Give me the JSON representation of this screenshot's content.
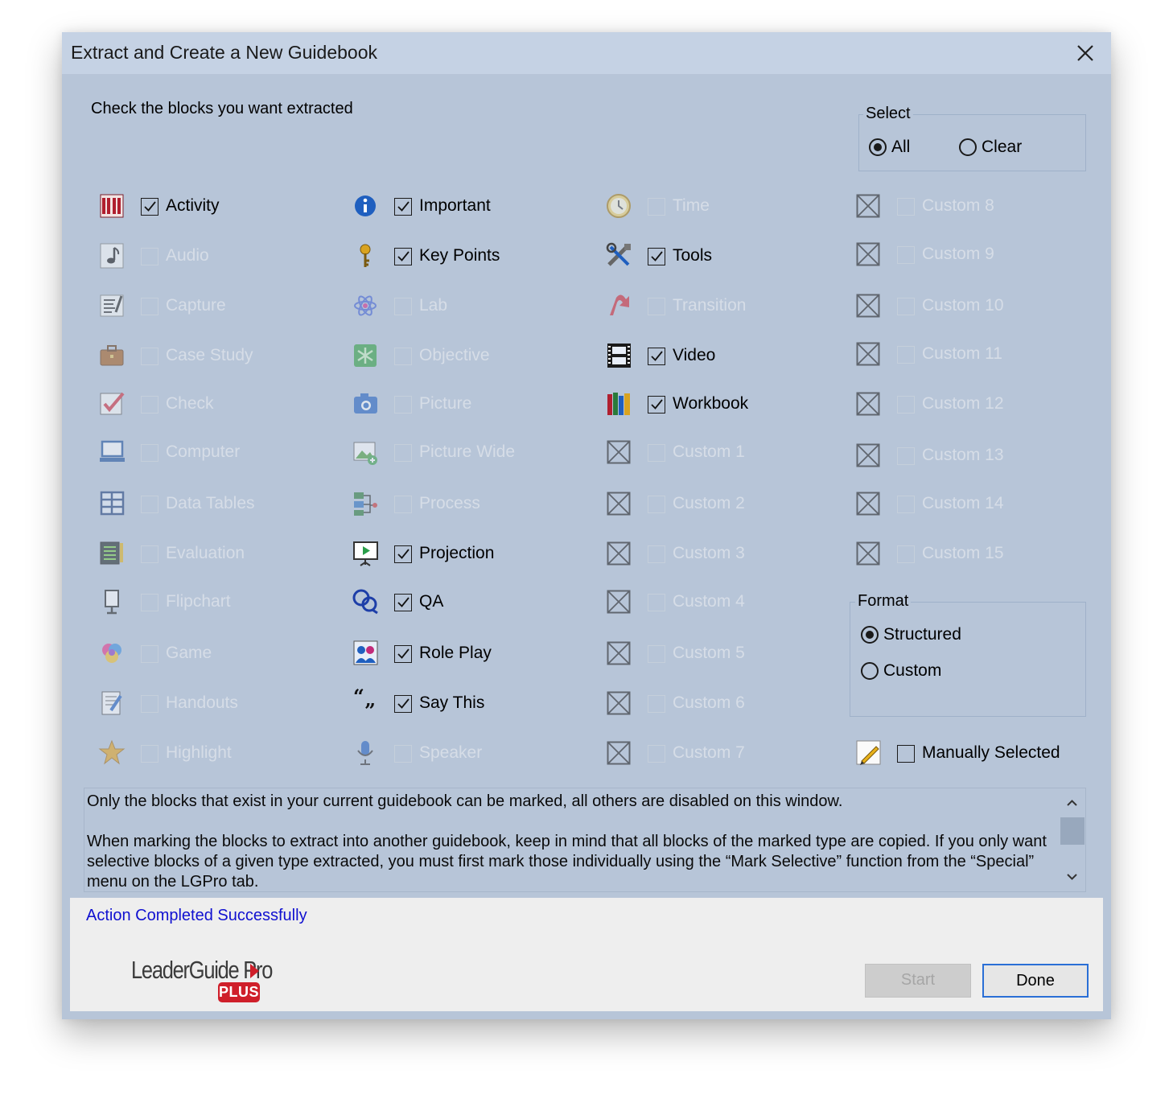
{
  "window": {
    "title": "Extract and Create a New Guidebook"
  },
  "prompt": "Check the blocks you want extracted",
  "select_group": {
    "legend": "Select",
    "options": [
      {
        "label": "All",
        "selected": true
      },
      {
        "label": "Clear",
        "selected": false
      }
    ]
  },
  "format_group": {
    "legend": "Format",
    "options": [
      {
        "label": "Structured",
        "selected": true
      },
      {
        "label": "Custom",
        "selected": false
      }
    ]
  },
  "blocks": [
    {
      "label": "Activity",
      "icon": "activity-icon",
      "enabled": true,
      "checked": true
    },
    {
      "label": "Audio",
      "icon": "audio-note-icon",
      "enabled": false,
      "checked": false
    },
    {
      "label": "Capture",
      "icon": "capture-icon",
      "enabled": false,
      "checked": false
    },
    {
      "label": "Case Study",
      "icon": "briefcase-icon",
      "enabled": false,
      "checked": false
    },
    {
      "label": "Check",
      "icon": "checkmark-icon",
      "enabled": false,
      "checked": false
    },
    {
      "label": "Computer",
      "icon": "computer-icon",
      "enabled": false,
      "checked": false
    },
    {
      "label": "Data Tables",
      "icon": "table-grid-icon",
      "enabled": false,
      "checked": false
    },
    {
      "label": "Evaluation",
      "icon": "evaluation-icon",
      "enabled": false,
      "checked": false
    },
    {
      "label": "Flipchart",
      "icon": "flipchart-icon",
      "enabled": false,
      "checked": false
    },
    {
      "label": "Game",
      "icon": "game-icon",
      "enabled": false,
      "checked": false
    },
    {
      "label": "Handouts",
      "icon": "handouts-icon",
      "enabled": false,
      "checked": false
    },
    {
      "label": "Highlight",
      "icon": "star-icon",
      "enabled": false,
      "checked": false
    },
    {
      "label": "Important",
      "icon": "info-icon",
      "enabled": true,
      "checked": true
    },
    {
      "label": "Key Points",
      "icon": "key-icon",
      "enabled": true,
      "checked": true
    },
    {
      "label": "Lab",
      "icon": "atom-icon",
      "enabled": false,
      "checked": false
    },
    {
      "label": "Objective",
      "icon": "objective-icon",
      "enabled": false,
      "checked": false
    },
    {
      "label": "Picture",
      "icon": "camera-icon",
      "enabled": false,
      "checked": false
    },
    {
      "label": "Picture Wide",
      "icon": "picture-wide-icon",
      "enabled": false,
      "checked": false
    },
    {
      "label": "Process",
      "icon": "process-icon",
      "enabled": false,
      "checked": false
    },
    {
      "label": "Projection",
      "icon": "projection-screen-icon",
      "enabled": true,
      "checked": true
    },
    {
      "label": "QA",
      "icon": "speech-bubbles-icon",
      "enabled": true,
      "checked": true
    },
    {
      "label": "Role Play",
      "icon": "role-play-icon",
      "enabled": true,
      "checked": true
    },
    {
      "label": "Say This",
      "icon": "quote-marks-icon",
      "enabled": true,
      "checked": true
    },
    {
      "label": "Speaker",
      "icon": "microphone-icon",
      "enabled": false,
      "checked": false
    },
    {
      "label": "Time",
      "icon": "clock-icon",
      "enabled": false,
      "checked": false
    },
    {
      "label": "Tools",
      "icon": "tools-icon",
      "enabled": true,
      "checked": true
    },
    {
      "label": "Transition",
      "icon": "transition-arrow-icon",
      "enabled": false,
      "checked": false
    },
    {
      "label": "Video",
      "icon": "film-icon",
      "enabled": true,
      "checked": true
    },
    {
      "label": "Workbook",
      "icon": "books-icon",
      "enabled": true,
      "checked": true
    },
    {
      "label": "Custom 1",
      "icon": "custom-block-icon",
      "enabled": false,
      "checked": false
    },
    {
      "label": "Custom 2",
      "icon": "custom-block-icon",
      "enabled": false,
      "checked": false
    },
    {
      "label": "Custom 3",
      "icon": "custom-block-icon",
      "enabled": false,
      "checked": false
    },
    {
      "label": "Custom 4",
      "icon": "custom-block-icon",
      "enabled": false,
      "checked": false
    },
    {
      "label": "Custom 5",
      "icon": "custom-block-icon",
      "enabled": false,
      "checked": false
    },
    {
      "label": "Custom 6",
      "icon": "custom-block-icon",
      "enabled": false,
      "checked": false
    },
    {
      "label": "Custom 7",
      "icon": "custom-block-icon",
      "enabled": false,
      "checked": false
    },
    {
      "label": "Custom 8",
      "icon": "custom-block-icon",
      "enabled": false,
      "checked": false
    },
    {
      "label": "Custom 9",
      "icon": "custom-block-icon",
      "enabled": false,
      "checked": false
    },
    {
      "label": "Custom 10",
      "icon": "custom-block-icon",
      "enabled": false,
      "checked": false
    },
    {
      "label": "Custom 11",
      "icon": "custom-block-icon",
      "enabled": false,
      "checked": false
    },
    {
      "label": "Custom 12",
      "icon": "custom-block-icon",
      "enabled": false,
      "checked": false
    },
    {
      "label": "Custom 13",
      "icon": "custom-block-icon",
      "enabled": false,
      "checked": false
    },
    {
      "label": "Custom 14",
      "icon": "custom-block-icon",
      "enabled": false,
      "checked": false
    },
    {
      "label": "Custom 15",
      "icon": "custom-block-icon",
      "enabled": false,
      "checked": false
    },
    {
      "label": "Manually Selected",
      "icon": "pencil-icon",
      "enabled": true,
      "checked": false
    }
  ],
  "info_text": [
    "Only the blocks that exist in your current guidebook can be marked, all others are disabled on this window.",
    "When marking the blocks to extract into another guidebook, keep in mind that all blocks of the marked type are copied. If you only want selective blocks of a given type extracted, you must first mark those individually using the “Mark Selective” function from the “Special” menu on the LGPro tab."
  ],
  "status": "Action Completed Successfully",
  "logo": {
    "text": "LeaderGuide Pro",
    "badge": "PLUS"
  },
  "buttons": {
    "start": "Start",
    "done": "Done"
  },
  "colors": {
    "dialog_bg": "#b7c5d8",
    "titlebar_bg": "#c5d2e4",
    "footer_bg": "#eeeeee",
    "status_text": "#1010d0",
    "logo_red": "#cf1f2a",
    "done_border": "#2a6fd6"
  }
}
